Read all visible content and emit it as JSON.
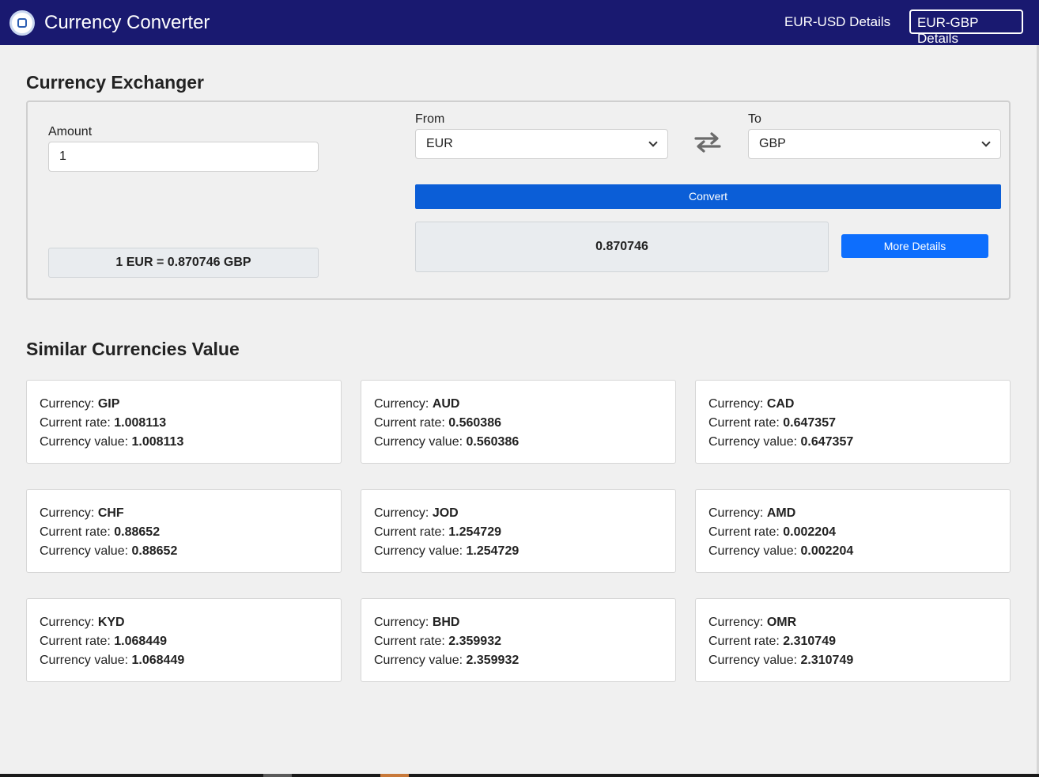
{
  "header": {
    "title": "Currency Converter",
    "logo_icon": "currency-logo-icon",
    "nav": [
      {
        "label": "EUR-USD Details"
      },
      {
        "label": "EUR-GBP Details"
      }
    ],
    "background": "#191970"
  },
  "exchanger": {
    "heading": "Currency Exchanger",
    "amount_label": "Amount",
    "amount_value": "1",
    "from_label": "From",
    "from_value": "EUR",
    "to_label": "To",
    "to_value": "GBP",
    "swap_icon": "swap-arrows-icon",
    "convert_label": "Convert",
    "result": "0.870746",
    "more_details_label": "More Details",
    "rate_text": "1 EUR = 0.870746 GBP"
  },
  "similar": {
    "heading": "Similar Currencies Value",
    "currency_label": "Currency:",
    "rate_label": "Current rate:",
    "value_label": "Currency value:",
    "cards": [
      {
        "currency": "GIP",
        "rate": "1.008113",
        "value": "1.008113"
      },
      {
        "currency": "AUD",
        "rate": "0.560386",
        "value": "0.560386"
      },
      {
        "currency": "CAD",
        "rate": "0.647357",
        "value": "0.647357"
      },
      {
        "currency": "CHF",
        "rate": "0.88652",
        "value": "0.88652"
      },
      {
        "currency": "JOD",
        "rate": "1.254729",
        "value": "1.254729"
      },
      {
        "currency": "AMD",
        "rate": "0.002204",
        "value": "0.002204"
      },
      {
        "currency": "KYD",
        "rate": "1.068449",
        "value": "1.068449"
      },
      {
        "currency": "BHD",
        "rate": "2.359932",
        "value": "2.359932"
      },
      {
        "currency": "OMR",
        "rate": "2.310749",
        "value": "2.310749"
      }
    ]
  },
  "colors": {
    "primary_button": "#0b5ed7",
    "secondary_button": "#0d6efd",
    "page_background": "#f0f0f0"
  }
}
